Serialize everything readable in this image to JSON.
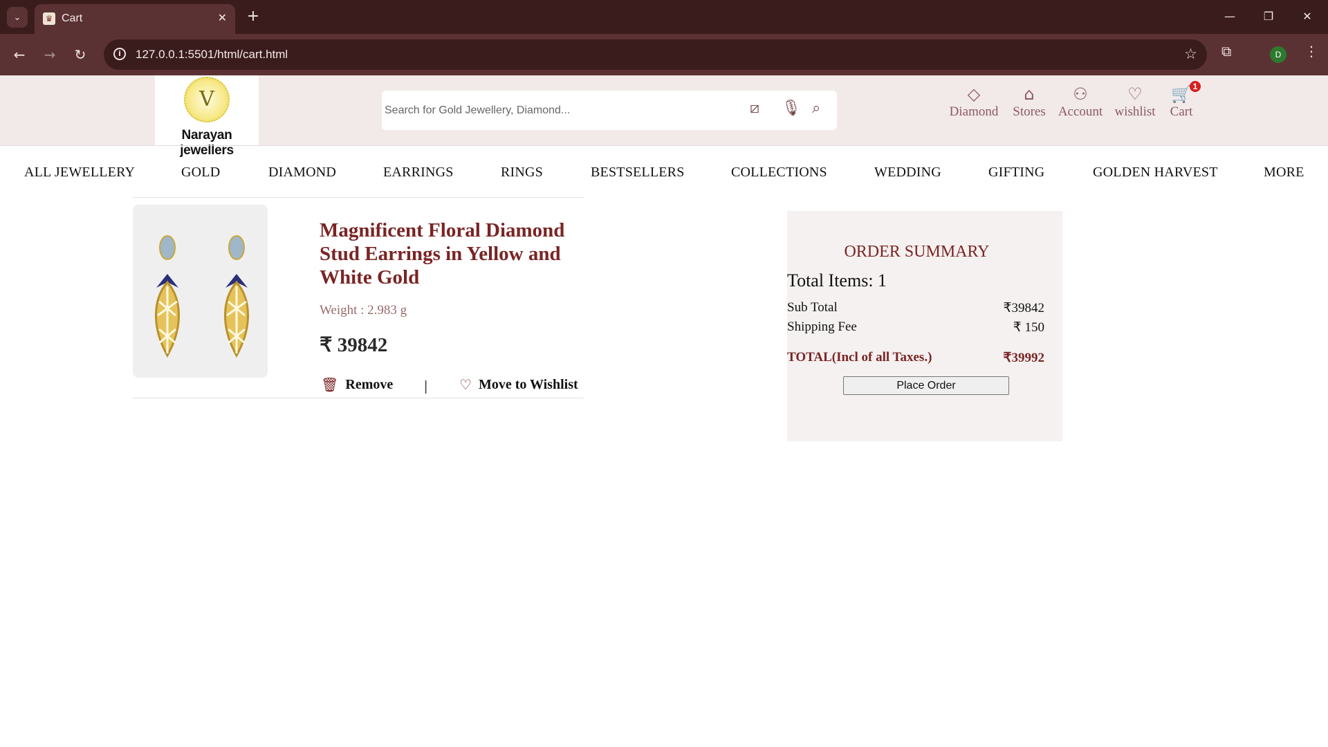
{
  "browser": {
    "tab_title": "Cart",
    "url": "127.0.0.1:5501/html/cart.html",
    "profile_initial": "D"
  },
  "header": {
    "brand": "Narayan jewellers",
    "search_placeholder": "Search for Gold Jewellery, Diamond...",
    "nav": [
      {
        "label": "Diamond",
        "icon": "diamond-icon"
      },
      {
        "label": "Stores",
        "icon": "store-icon"
      },
      {
        "label": "Account",
        "icon": "account-icon"
      },
      {
        "label": "wishlist",
        "icon": "heart-icon"
      },
      {
        "label": "Cart",
        "icon": "cart-icon"
      }
    ],
    "cart_count": "1"
  },
  "categories": [
    "ALL JEWELLERY",
    "GOLD",
    "DIAMOND",
    "EARRINGS",
    "RINGS",
    "BESTSELLERS",
    "COLLECTIONS",
    "WEDDING",
    "GIFTING",
    "GOLDEN HARVEST",
    "MORE"
  ],
  "cart_item": {
    "name": "Magnificent Floral Diamond Stud Earrings in Yellow and White Gold",
    "weight": "Weight : 2.983 g",
    "price": "₹ 39842",
    "remove_label": "Remove",
    "separator": "|",
    "wishlist_label": "Move to Wishlist"
  },
  "summary": {
    "title": "ORDER SUMMARY",
    "total_items": "Total Items: 1",
    "subtotal_label": "Sub Total",
    "subtotal_value": "₹39842",
    "shipping_label": "Shipping Fee",
    "shipping_value": "₹ 150",
    "total_label": "TOTAL(Incl of all Taxes.)",
    "total_value": "₹39992",
    "place_order": "Place Order"
  },
  "colors": {
    "accent": "#7a2424",
    "header_bg": "#f2e9e9",
    "chrome_dark": "#3b1c1d",
    "chrome_mid": "#5b3233"
  }
}
